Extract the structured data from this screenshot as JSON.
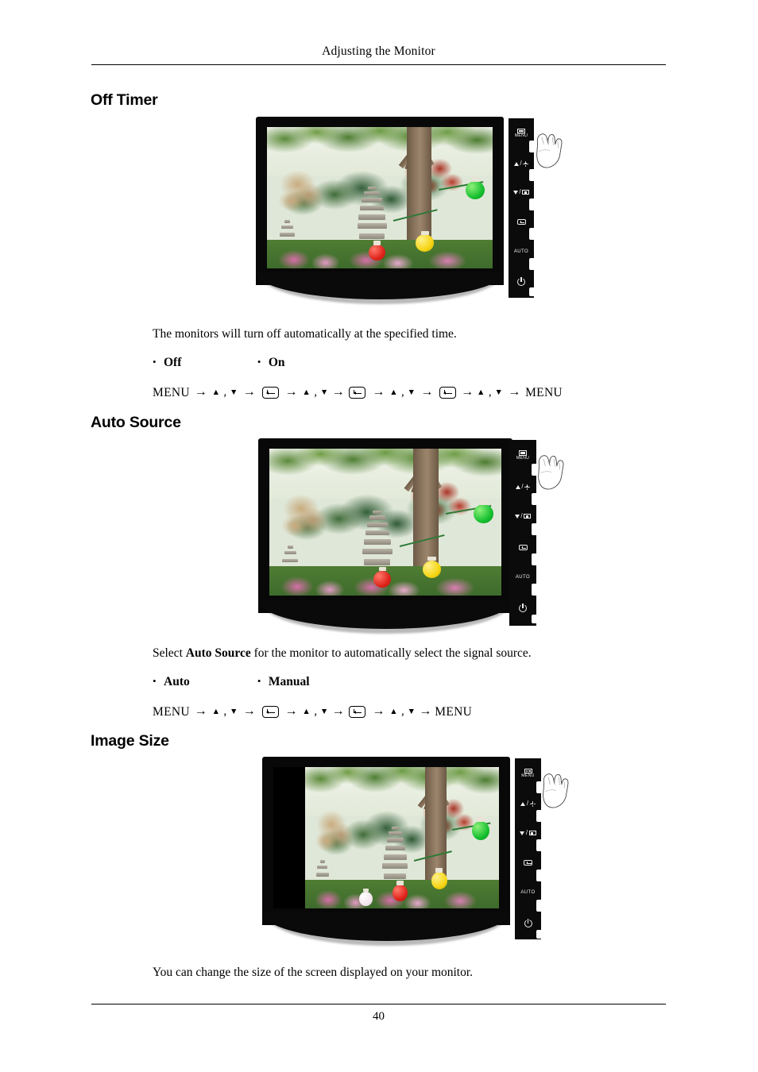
{
  "header": {
    "title": "Adjusting the Monitor"
  },
  "footer": {
    "page_number": "40"
  },
  "sections": [
    {
      "id": "off-timer",
      "heading": "Off Timer",
      "description": "The monitors will turn off automatically at the specified time.",
      "options": [
        "Off",
        "On"
      ],
      "nav_label_start": "MENU",
      "nav_label_end": "MENU"
    },
    {
      "id": "auto-source",
      "heading": "Auto Source",
      "description_prefix": "Select ",
      "description_bold": "Auto Source",
      "description_suffix": " for the monitor to automatically select the signal source.",
      "options": [
        "Auto",
        "Manual"
      ],
      "nav_label_start": "MENU",
      "nav_label_end": "MENU"
    },
    {
      "id": "image-size",
      "heading": "Image Size",
      "description": "You can change the size of the screen displayed on your monitor."
    }
  ],
  "monitor_controls": {
    "menu_label": "MENU",
    "auto_label": "AUTO",
    "icons": [
      "menu-bars-icon",
      "up-brightness-icon",
      "down-image-icon",
      "enter-icon",
      "auto-icon",
      "power-icon"
    ]
  },
  "figure": {
    "screen_photo_description": "Korean temple garden with stone pagodas, trees and paper lanterns",
    "pointer": "hand-pointer-graphic"
  },
  "glyphs": {
    "bullet": "•",
    "arrow": "→",
    "up_triangle": "▲",
    "down_triangle": "▼",
    "comma": ","
  }
}
